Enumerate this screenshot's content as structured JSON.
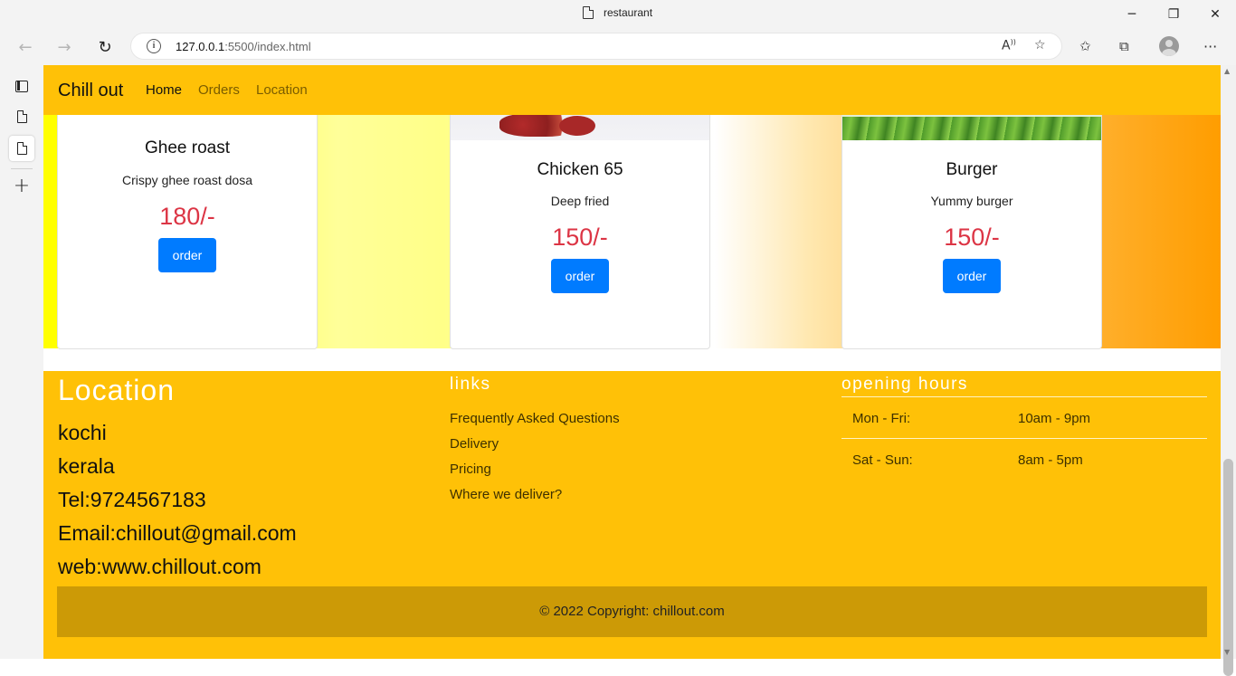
{
  "browser": {
    "tab_title": "restaurant",
    "url_host": "127.0.0.1",
    "url_rest": ":5500/index.html",
    "window_controls": [
      "minimize",
      "maximize",
      "close"
    ]
  },
  "navbar": {
    "brand": "Chill out",
    "links": [
      {
        "label": "Home",
        "active": true
      },
      {
        "label": "Orders",
        "active": false
      },
      {
        "label": "Location",
        "active": false
      }
    ]
  },
  "menu": {
    "cards": [
      {
        "name": "Ghee roast",
        "description": "Crispy ghee roast dosa",
        "price": "180/-",
        "button": "order"
      },
      {
        "name": "Chicken 65",
        "description": "Deep fried",
        "price": "150/-",
        "button": "order"
      },
      {
        "name": "Burger",
        "description": "Yummy burger",
        "price": "150/-",
        "button": "order"
      }
    ]
  },
  "footer": {
    "location_heading": "Location",
    "location_lines": [
      "kochi",
      "kerala",
      "Tel:9724567183",
      "Email:chillout@gmail.com",
      "web:www.chillout.com"
    ],
    "links_heading": "links",
    "links": [
      "Frequently Asked Questions",
      "Delivery",
      "Pricing",
      "Where we deliver?"
    ],
    "hours_heading": "opening hours",
    "hours": [
      {
        "day": "Mon - Fri:",
        "time": "10am - 9pm"
      },
      {
        "day": "Sat - Sun:",
        "time": "8am - 5pm"
      }
    ],
    "copyright_prefix": "© 2022 Copyright: ",
    "copyright_link": "chillout.com"
  },
  "colors": {
    "navbar": "#ffc107",
    "price": "#dc3545",
    "button": "#007bff",
    "copyright_bar": "#cc9a06"
  }
}
